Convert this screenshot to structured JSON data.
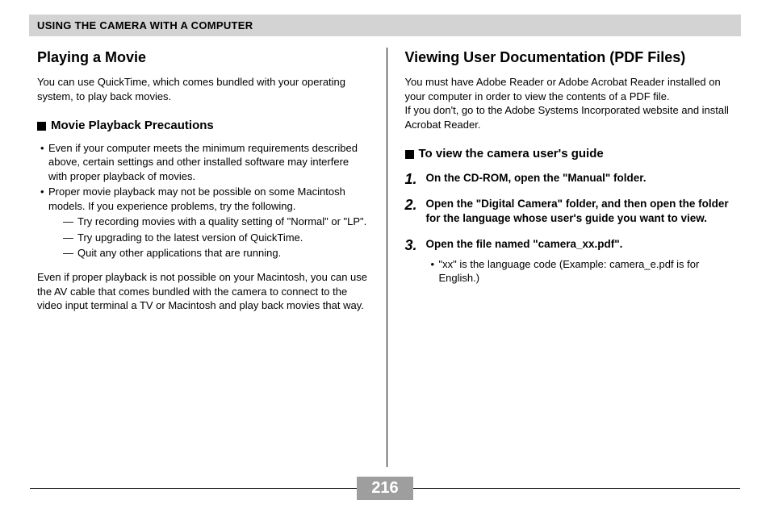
{
  "header": "USING THE CAMERA WITH A COMPUTER",
  "left": {
    "title": "Playing a Movie",
    "intro": "You can use QuickTime, which comes bundled with your operating system, to play back movies.",
    "subheading": "Movie Playback Precautions",
    "bullets": [
      "Even if your computer meets the minimum requirements described above, certain settings and other installed software may interfere with proper playback of movies.",
      "Proper movie playback may not be possible on some Macintosh models. If you experience problems, try the following."
    ],
    "dashes": [
      "Try recording movies with a quality setting of \"Normal\" or \"LP\".",
      "Try upgrading to the latest version of QuickTime.",
      "Quit any other applications that are running."
    ],
    "closing": "Even if proper playback is not possible on your Macintosh, you can use the AV cable that comes bundled with the camera to connect to the video input terminal a TV or Macintosh and play back movies that way."
  },
  "right": {
    "title": "Viewing User Documentation (PDF Files)",
    "intro1": "You must have Adobe Reader or Adobe Acrobat Reader installed on your computer in order to view the contents of a PDF file.",
    "intro2": "If you don't, go to the Adobe Systems Incorporated website and install Acrobat Reader.",
    "subheading": "To view the camera user's guide",
    "steps": [
      {
        "n": "1.",
        "text": "On the CD-ROM, open the \"Manual\" folder."
      },
      {
        "n": "2.",
        "text": "Open the \"Digital Camera\" folder, and then open the folder for the language whose user's guide you want to view."
      },
      {
        "n": "3.",
        "text": "Open the file named \"camera_xx.pdf\"."
      }
    ],
    "step3_note": "\"xx\" is the language code (Example: camera_e.pdf is for English.)"
  },
  "page": "216"
}
